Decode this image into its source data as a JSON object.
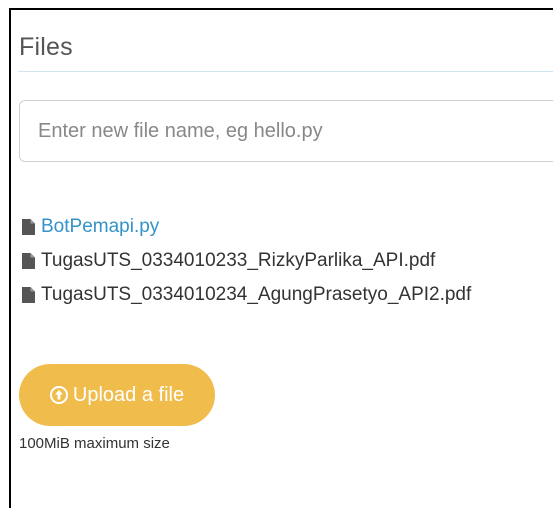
{
  "panel": {
    "title": "Files"
  },
  "new_file": {
    "placeholder": "Enter new file name, eg hello.py",
    "value": ""
  },
  "files": [
    {
      "name": "BotPemapi.py",
      "is_link": true,
      "icon": "file-icon"
    },
    {
      "name": "TugasUTS_0334010233_RizkyParlika_API.pdf",
      "is_link": false,
      "icon": "file-icon"
    },
    {
      "name": "TugasUTS_0334010234_AgungPrasetyo_API2.pdf",
      "is_link": false,
      "icon": "file-icon"
    }
  ],
  "upload": {
    "label": "Upload a file",
    "icon": "upload-circle-icon",
    "max_size_note": "100MiB maximum size"
  },
  "colors": {
    "link": "#3393c9",
    "upload_button": "#f0bd4d",
    "title_rule": "#cfe6f2"
  }
}
